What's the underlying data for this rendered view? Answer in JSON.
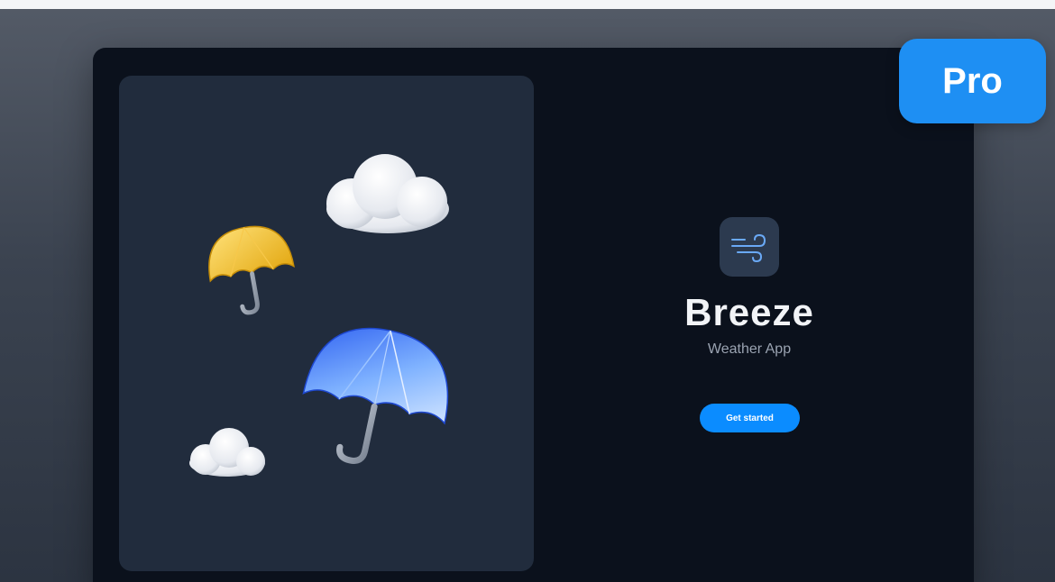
{
  "app": {
    "name": "Breeze",
    "subtitle": "Weather App",
    "cta_label": "Get started"
  },
  "badge": {
    "label": "Pro"
  },
  "icons": {
    "app_icon": "wind-icon"
  },
  "illustration": {
    "items": [
      "cloud",
      "yellow-umbrella",
      "blue-umbrella",
      "small-cloud"
    ]
  },
  "colors": {
    "accent": "#0b8cff",
    "badge": "#1e8ff3",
    "background": "#0b111c",
    "panel": "#212c3d"
  }
}
